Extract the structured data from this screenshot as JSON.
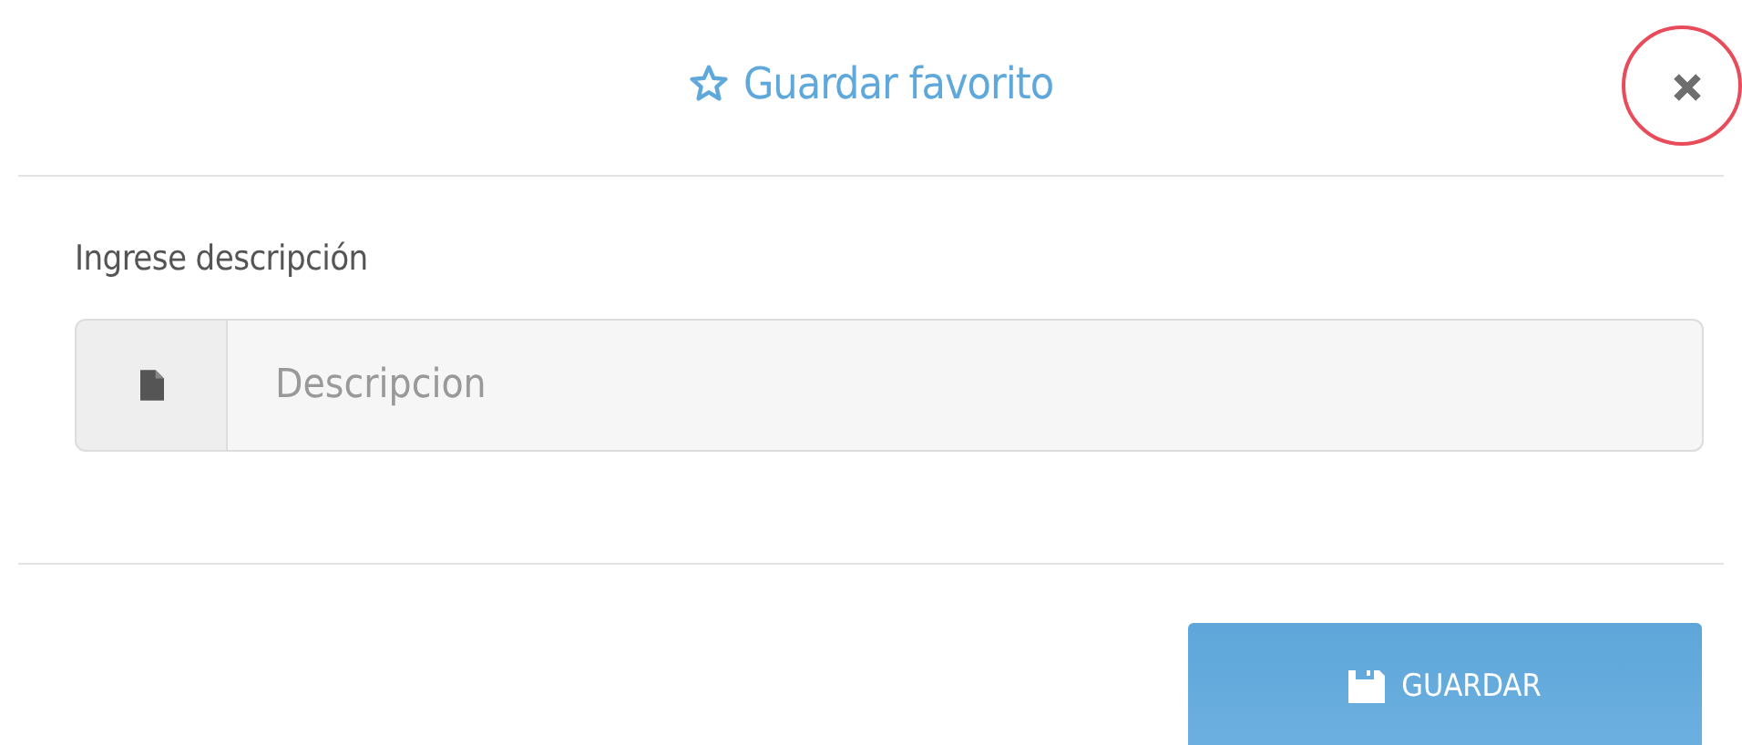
{
  "dialog": {
    "title": "Guardar favorito",
    "close_highlighted": true
  },
  "field": {
    "label": "Ingrese descripción",
    "placeholder": "Descripcion"
  },
  "buttons": [
    {
      "label": "GUARDAR",
      "kind": "primary"
    }
  ]
}
